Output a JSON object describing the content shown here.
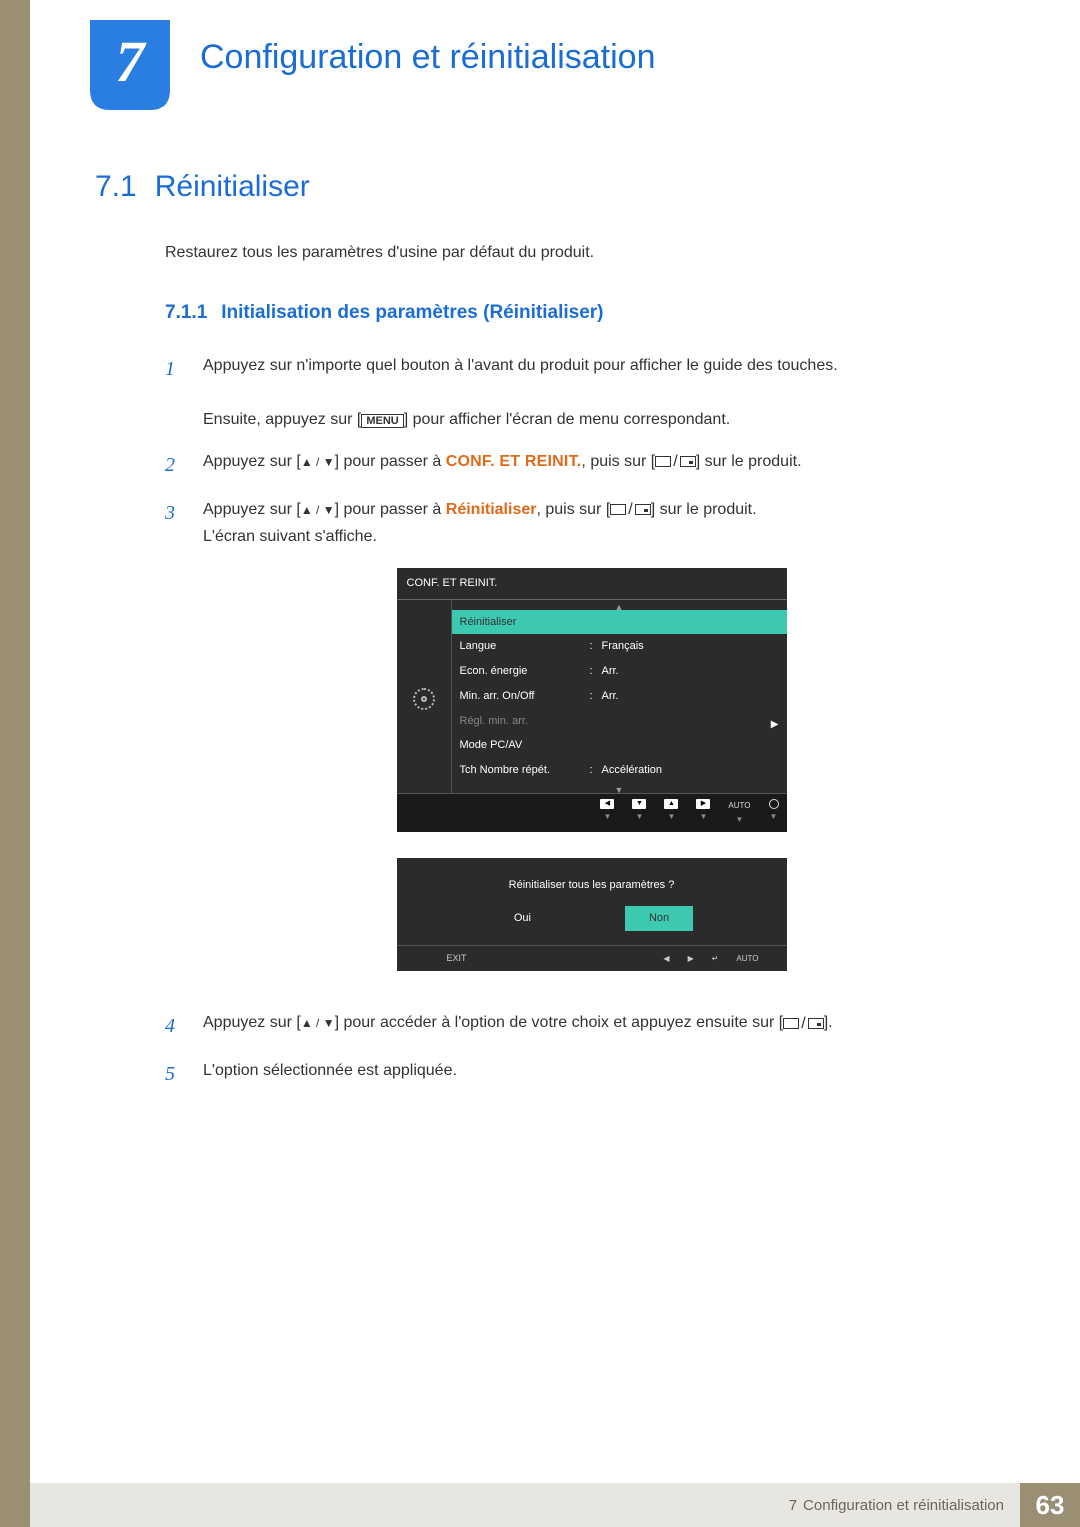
{
  "chapter": {
    "number": "7",
    "title": "Configuration et réinitialisation"
  },
  "section": {
    "number": "7.1",
    "title": "Réinitialiser"
  },
  "intro_text": "Restaurez tous les paramètres d'usine par défaut du produit.",
  "subsection": {
    "number": "7.1.1",
    "title": "Initialisation des paramètres (Réinitialiser)"
  },
  "steps": {
    "1": {
      "line1_a": "Appuyez sur n'importe quel bouton à l'avant du produit pour afficher le guide des touches.",
      "line2_a": "Ensuite, appuyez sur [",
      "menu_btn": "MENU",
      "line2_b": "] pour afficher l'écran de menu correspondant."
    },
    "2": {
      "a": "Appuyez sur [",
      "b": "] pour passer à ",
      "target": "CONF. ET REINIT.",
      "c": ", puis sur [",
      "d": "] sur le produit."
    },
    "3": {
      "a": "Appuyez sur [",
      "b": "] pour passer à ",
      "target": "Réinitialiser",
      "c": ", puis sur [",
      "d": "] sur le produit.",
      "e": "L'écran suivant s'affiche."
    },
    "4": {
      "a": "Appuyez sur [",
      "b": "] pour accéder à l'option de votre choix et appuyez ensuite sur [",
      "c": "]."
    },
    "5": {
      "a": "L'option sélectionnée est appliquée."
    }
  },
  "osd1": {
    "title": "CONF. ET REINIT.",
    "rows": [
      {
        "label": "Réinitialiser",
        "val": "",
        "hl": true
      },
      {
        "label": "Langue",
        "val": "Français"
      },
      {
        "label": "Econ. énergie",
        "val": "Arr."
      },
      {
        "label": "Min. arr. On/Off",
        "val": "Arr."
      },
      {
        "label": "Régl. min. arr.",
        "val": "",
        "dim": true
      },
      {
        "label": "Mode PC/AV",
        "val": ""
      },
      {
        "label": "Tch Nombre répét.",
        "val": "Accélération"
      }
    ],
    "nav": {
      "auto_label": "AUTO"
    }
  },
  "osd2": {
    "prompt": "Réinitialiser tous les paramètres ?",
    "yes": "Oui",
    "no": "Non",
    "exit": "EXIT",
    "auto": "AUTO"
  },
  "footer": {
    "chapter_num": "7",
    "chapter_title": "Configuration et réinitialisation",
    "page": "63"
  },
  "glyphs": {
    "updown": "▲ / ▼",
    "arrow_right": "▶",
    "left_box": "◀",
    "down_box": "▼",
    "up_box": "▲",
    "right_box": "▶",
    "enter_box": "↵"
  }
}
